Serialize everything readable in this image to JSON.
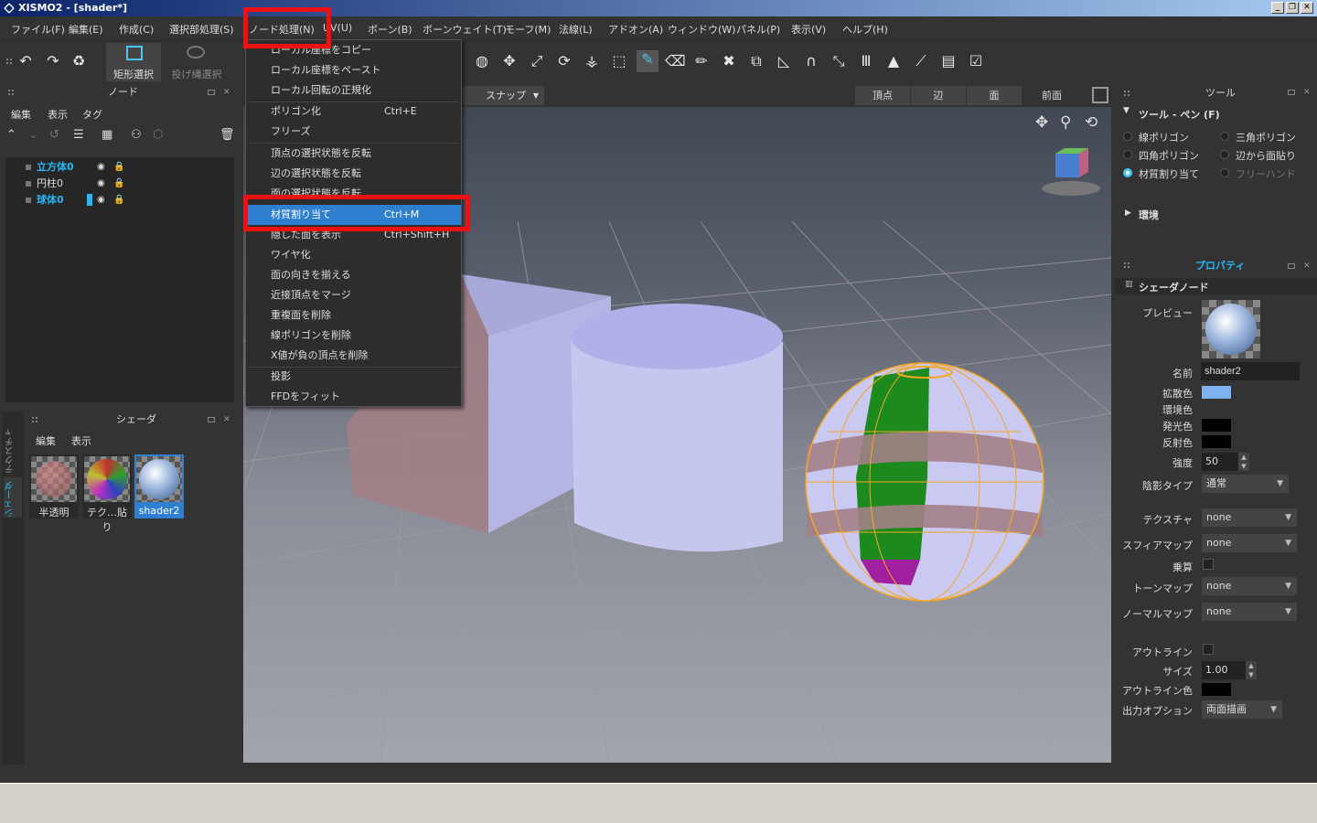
{
  "window": {
    "title": "XISMO2 - [shader*]"
  },
  "menubar": [
    "ファイル(F)",
    "編集(E)",
    "作成(C)",
    "選択部処理(S)",
    "ノード処理(N)",
    "UV(U)",
    "ボーン(B)",
    "ボーンウェイト(T)",
    "モーフ(M)",
    "法線(L)",
    "アドオン(A)",
    "ウィンドウ(W)",
    "パネル(P)",
    "表示(V)",
    "ヘルプ(H)"
  ],
  "toolbar": {
    "rect_select": "矩形選択",
    "lasso_select": "投げ縄選択"
  },
  "dropdown": {
    "items": [
      {
        "label": "ローカル座標をコピー",
        "shortcut": ""
      },
      {
        "label": "ローカル座標をペースト",
        "shortcut": ""
      },
      {
        "label": "ローカル回転の正規化",
        "shortcut": ""
      },
      {
        "label": "ポリゴン化",
        "shortcut": "Ctrl+E"
      },
      {
        "label": "フリーズ",
        "shortcut": ""
      },
      {
        "label": "頂点の選択状態を反転",
        "shortcut": ""
      },
      {
        "label": "辺の選択状態を反転",
        "shortcut": ""
      },
      {
        "label": "面の選択状態を反転",
        "shortcut": ""
      },
      {
        "label": "材質割り当て",
        "shortcut": "Ctrl+M"
      },
      {
        "label": "隠した面を表示",
        "shortcut": "Ctrl+Shift+H"
      },
      {
        "label": "ワイヤ化",
        "shortcut": ""
      },
      {
        "label": "面の向きを揃える",
        "shortcut": ""
      },
      {
        "label": "近接頂点をマージ",
        "shortcut": ""
      },
      {
        "label": "重複面を削除",
        "shortcut": ""
      },
      {
        "label": "線ポリゴンを削除",
        "shortcut": ""
      },
      {
        "label": "X値が負の頂点を削除",
        "shortcut": ""
      },
      {
        "label": "投影",
        "shortcut": ""
      },
      {
        "label": "FFDをフィット",
        "shortcut": ""
      }
    ]
  },
  "node_panel": {
    "title": "ノード",
    "menu": [
      "編集",
      "表示",
      "タグ"
    ],
    "nodes": [
      "立方体0",
      "円柱0",
      "球体0"
    ]
  },
  "shader_panel": {
    "title": "シェーダ",
    "menu": [
      "編集",
      "表示"
    ],
    "side_tabs": [
      "テクスチャ",
      "シェーダ"
    ],
    "shaders": [
      "半透明",
      "テク…貼り",
      "shader2"
    ]
  },
  "viewport": {
    "snap": "スナップ",
    "modes": [
      "頂点",
      "辺",
      "面"
    ],
    "view": "前面"
  },
  "tool_panel": {
    "title": "ツール",
    "section": "ツール - ペン (F)",
    "options_left": [
      "線ポリゴン",
      "四角ポリゴン",
      "材質割り当て"
    ],
    "options_right": [
      "三角ポリゴン",
      "辺から面貼り",
      "フリーハンド"
    ],
    "env": "環境"
  },
  "property_panel": {
    "title": "プロパティ",
    "section": "シェーダノード",
    "preview_label": "プレビュー",
    "name_label": "名前",
    "name_value": "shader2",
    "diffuse_label": "拡散色",
    "ambient_label": "環境色",
    "emissive_label": "発光色",
    "specular_label": "反射色",
    "strength_label": "強度",
    "strength_value": "50",
    "shading_label": "陰影タイプ",
    "shading_value": "通常",
    "texture_label": "テクスチャ",
    "texture_value": "none",
    "spheremap_label": "スフィアマップ",
    "spheremap_value": "none",
    "multiply_label": "乗算",
    "toonmap_label": "トーンマップ",
    "toonmap_value": "none",
    "normalmap_label": "ノーマルマップ",
    "normalmap_value": "none",
    "outline_label": "アウトライン",
    "size_label": "サイズ",
    "size_value": "1.00",
    "outline_color_label": "アウトライン色",
    "output_label": "出力オプション",
    "output_value": "両面描画"
  },
  "colors": {
    "accent": "#2f7fd0",
    "highlight": "#ee1111",
    "selected_text": "#29b6f6",
    "diffuse": "#7fb2f0"
  }
}
